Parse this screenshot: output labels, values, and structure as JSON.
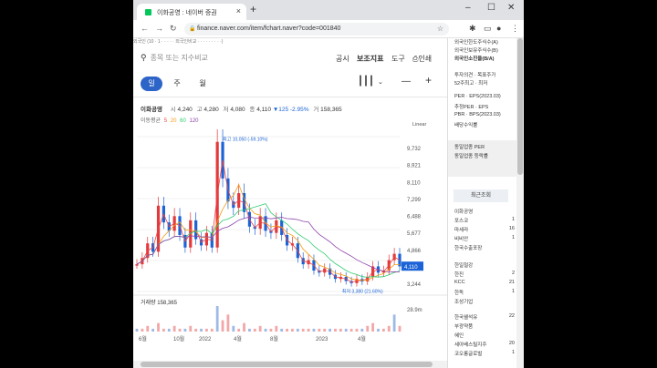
{
  "browser": {
    "tab_title": "이화공영 : 네이버 증권",
    "tab_close": "×",
    "new_tab": "+",
    "url": "finance.naver.com/item/fchart.naver?code=001840"
  },
  "main": {
    "top_strip": "외국인 (10 · 1 · · · · · 외국인비교 · · · · · · · · ·)",
    "search_placeholder": "종목 또는 지수비교",
    "menu": [
      "공시",
      "보조지표",
      "도구",
      "인쇄"
    ],
    "period_tabs": [
      "일",
      "주",
      "월"
    ],
    "active_period": "일",
    "stock": {
      "name": "이화공영",
      "open_label": "시",
      "open": "4,240",
      "high_label": "고",
      "high": "4,280",
      "low_label": "저",
      "low": "4,080",
      "close_label": "종",
      "close": "4,110",
      "change": "▼125 -2.95%",
      "volume_label": "거",
      "volume": "158,365"
    },
    "ma_label": "이동평균",
    "ma": [
      {
        "p": "5",
        "c": "#e44"
      },
      {
        "p": "20",
        "c": "#f39c12"
      },
      {
        "p": "60",
        "c": "#2ecc71"
      },
      {
        "p": "120",
        "c": "#8e44ad"
      }
    ],
    "scale_mode": "Linear"
  },
  "chart_data": {
    "type": "line",
    "title": "이화공영",
    "y_ticks": [
      "9,732",
      "8,921",
      "8,110",
      "7,299",
      "6,488",
      "5,677",
      "4,866",
      "4,110",
      "3,244"
    ],
    "x_ticks": [
      "6월",
      "10월",
      "2022",
      "4월",
      "8월",
      "2023",
      "4월"
    ],
    "price_series": [
      4200,
      4500,
      5200,
      4800,
      7000,
      6200,
      5800,
      6500,
      5600,
      5000,
      6300,
      5400,
      5100,
      5700,
      5000,
      10050,
      8300,
      7200,
      6900,
      7600,
      6700,
      6000,
      5900,
      6500,
      5800,
      5700,
      6300,
      5600,
      5100,
      5200,
      4500,
      4200,
      4400,
      3900,
      3800,
      4000,
      3700,
      3500,
      3600,
      3400,
      3300,
      3500,
      3380,
      3600,
      4100,
      3800,
      3900,
      4400,
      4700,
      4100
    ],
    "high_annotation": "최고 10,050 (-59.10%)",
    "low_annotation": "최저 3,380 (21.60%)",
    "last_price": "4,110",
    "volume_label": "거래량",
    "volume_value": "158,365",
    "volume_tick": "28.9m",
    "volume": [
      1,
      1,
      2,
      1,
      3,
      1,
      1,
      2,
      1,
      1,
      2,
      1,
      1,
      1,
      1,
      9,
      4,
      6,
      2,
      1,
      3,
      1,
      1,
      2,
      1,
      1,
      2,
      1,
      1,
      1,
      1,
      1,
      1,
      1,
      1,
      1,
      1,
      1,
      1,
      1,
      1,
      1,
      1,
      2,
      3,
      1,
      1,
      2,
      6,
      2
    ],
    "colors": {
      "up": "#e4393c",
      "down": "#1b63d6",
      "ma5": "#e44",
      "ma20": "#f39c12",
      "ma60": "#2ecc71",
      "ma120": "#8e44ad"
    }
  },
  "sidebar": {
    "top_items": [
      "외국인한도주식수(A)",
      "외국인보유주식수(B)",
      "외국인소진율(B/A)"
    ],
    "opinion": [
      "투자의견 · 목표주가",
      "52주최고 · 최저"
    ],
    "per": [
      "PER · EPS(2023.03)",
      "추정PER · EPS",
      "PBR · BPS(2023.03)",
      "배당수익률"
    ],
    "industry": [
      "동일업종 PER",
      "동일업종 등락률"
    ],
    "recent_title": "최근조회",
    "recent": [
      {
        "name": "이화공영",
        "v": ""
      },
      {
        "name": "포스코",
        "v": "1"
      },
      {
        "name": "마세라",
        "v": "16"
      },
      {
        "name": "비비안",
        "v": "1"
      },
      {
        "name": "한국수출포장",
        "v": ""
      },
      {
        "name": "한일철강",
        "v": ""
      },
      {
        "name": "한진",
        "v": "2"
      },
      {
        "name": "KCC",
        "v": "21"
      },
      {
        "name": "한독",
        "v": "1"
      },
      {
        "name": "조성기업",
        "v": ""
      },
      {
        "name": "한국쉘석유",
        "v": "22"
      },
      {
        "name": "부광약품",
        "v": ""
      },
      {
        "name": "혜인",
        "v": ""
      },
      {
        "name": "세아베스틸지주",
        "v": "20"
      },
      {
        "name": "코오롱글로벌",
        "v": "1"
      }
    ]
  }
}
